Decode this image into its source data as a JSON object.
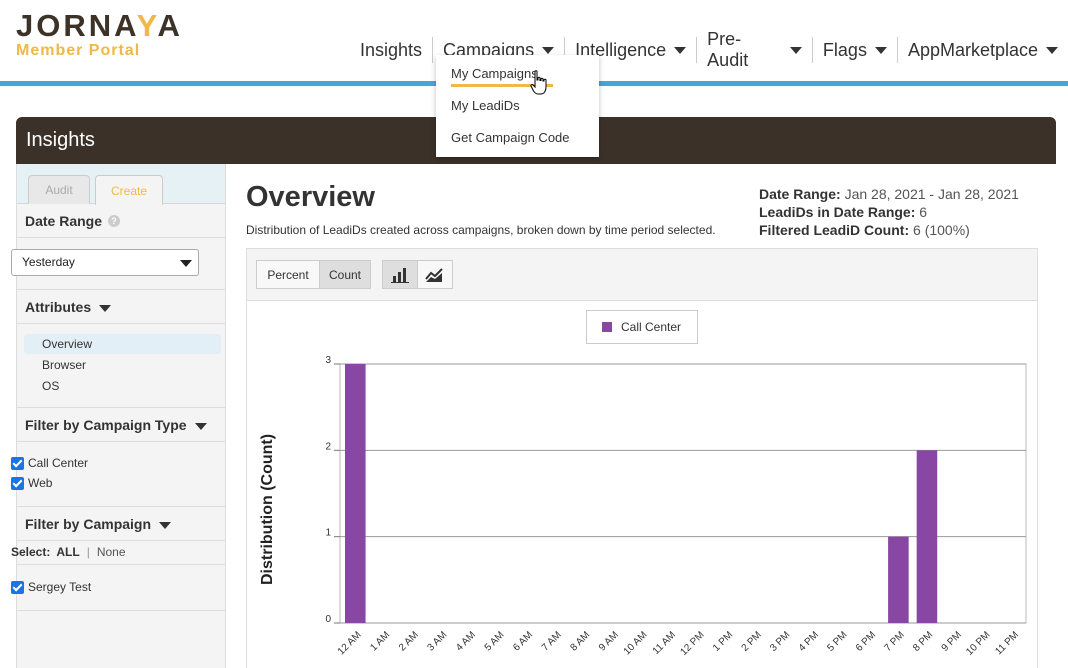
{
  "logo": {
    "main_a": "JORNA",
    "main_b": "Y",
    "main_c": "A",
    "sub": "Member Portal"
  },
  "nav": [
    {
      "label": "Insights",
      "has_caret": false
    },
    {
      "label": "Campaigns",
      "has_caret": true
    },
    {
      "label": "Intelligence",
      "has_caret": true
    },
    {
      "label": "Pre-Audit",
      "has_caret": true
    },
    {
      "label": "Flags",
      "has_caret": true
    },
    {
      "label": "AppMarketplace",
      "has_caret": true
    }
  ],
  "dropdown": [
    "My Campaigns",
    "My LeadiDs",
    "Get Campaign Code"
  ],
  "panel": {
    "title": "Insights"
  },
  "sidebar": {
    "tabs": [
      "Audit",
      "Create"
    ],
    "date_range": {
      "title": "Date Range",
      "help": "?",
      "selected": "Yesterday"
    },
    "attributes": {
      "title": "Attributes",
      "items": [
        "Overview",
        "Browser",
        "OS"
      ]
    },
    "campaign_type": {
      "title": "Filter by Campaign Type",
      "items": [
        "Call Center",
        "Web"
      ]
    },
    "campaign": {
      "title": "Filter by Campaign",
      "select_label": "Select:",
      "all": "ALL",
      "sep": "|",
      "none": "None",
      "items": [
        "Sergey Test"
      ]
    }
  },
  "main": {
    "title": "Overview",
    "description": "Distribution of LeadiDs created across campaigns, broken down by time period selected.",
    "stats": [
      {
        "label": "Date Range:",
        "value": "Jan 28, 2021 - Jan 28, 2021"
      },
      {
        "label": "LeadiDs in Date Range:",
        "value": "6"
      },
      {
        "label": "Filtered LeadiD Count:",
        "value": "6 (100%)"
      }
    ],
    "toolbar": {
      "percent": "Percent",
      "count": "Count",
      "bar_icon": "bar-chart-icon",
      "line_icon": "line-chart-icon"
    }
  },
  "chart_data": {
    "type": "bar",
    "ylabel": "Distribution (Count)",
    "ylim": [
      0,
      3
    ],
    "yticks": [
      0,
      1,
      2,
      3
    ],
    "grid": true,
    "legend_position": "top-center",
    "categories": [
      "12 AM",
      "1 AM",
      "2 AM",
      "3 AM",
      "4 AM",
      "5 AM",
      "6 AM",
      "7 AM",
      "8 AM",
      "9 AM",
      "10 AM",
      "11 AM",
      "12 PM",
      "1 PM",
      "2 PM",
      "3 PM",
      "4 PM",
      "5 PM",
      "6 PM",
      "7 PM",
      "8 PM",
      "9 PM",
      "10 PM",
      "11 PM"
    ],
    "series": [
      {
        "name": "Call Center",
        "color": "#8847a3",
        "values": [
          3,
          0,
          0,
          0,
          0,
          0,
          0,
          0,
          0,
          0,
          0,
          0,
          0,
          0,
          0,
          0,
          0,
          0,
          0,
          1,
          2,
          0,
          0,
          0
        ]
      }
    ]
  },
  "colors": {
    "accent": "#f0b848",
    "blue": "#45a6d8",
    "panel": "#3b3128",
    "series": "#8847a3"
  }
}
